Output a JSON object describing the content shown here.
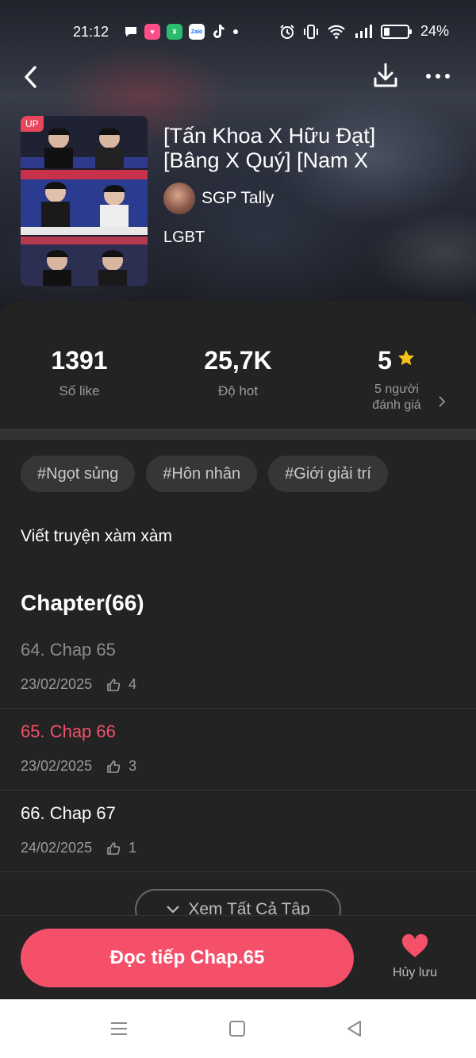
{
  "status_bar": {
    "time": "21:12",
    "battery": "24%"
  },
  "book": {
    "badge": "UP",
    "title_line1": "[Tấn Khoa X Hữu Đạt]",
    "title_line2": "[Bâng X Quý] [Nam X",
    "author": "SGP Tally",
    "genre": "LGBT"
  },
  "stats": {
    "likes_value": "1391",
    "likes_label": "Số like",
    "hot_value": "25,7K",
    "hot_label": "Độ hot",
    "rating_value": "5",
    "rating_label_line1": "5 người",
    "rating_label_line2": "đánh giá"
  },
  "tags": [
    "#Ngọt sủng",
    "#Hôn nhân",
    "#Giới giải trí"
  ],
  "description": "Viết truyện xàm xàm",
  "chapters": {
    "heading": "Chapter(66)",
    "items": [
      {
        "title": "64. Chap 65",
        "date": "23/02/2025",
        "likes": "4"
      },
      {
        "title": "65. Chap 66",
        "date": "23/02/2025",
        "likes": "3"
      },
      {
        "title": "66. Chap 67",
        "date": "24/02/2025",
        "likes": "1"
      }
    ],
    "view_all": "Xem Tất Cả Tập"
  },
  "actions": {
    "read_button": "Đọc tiếp Chap.65",
    "unsave_label": "Hủy lưu"
  },
  "colors": {
    "accent": "#f4506a",
    "read_chapter": "#8c8c8c",
    "current_chapter": "#f4506a",
    "unread_chapter": "#ffffff",
    "star": "#f8c21c"
  }
}
